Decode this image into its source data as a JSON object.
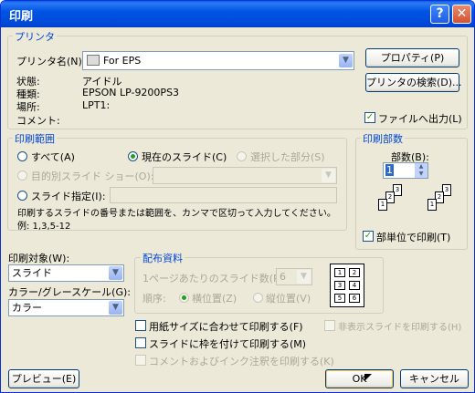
{
  "window": {
    "title": "印刷",
    "help_btn": "?",
    "close_btn": "✕"
  },
  "printer": {
    "group_label": "プリンタ",
    "name_label": "プリンタ名(N):",
    "name_value": "For EPS",
    "properties_btn": "プロパティ(P)",
    "find_btn": "プリンタの検索(D)...",
    "status_label": "状態:",
    "status_value": "アイドル",
    "type_label": "種類:",
    "type_value": "EPSON LP-9200PS3",
    "where_label": "場所:",
    "where_value": "LPT1:",
    "comment_label": "コメント:",
    "print_to_file": "ファイルへ出力(L)"
  },
  "range": {
    "group_label": "印刷範囲",
    "all": "すべて(A)",
    "current": "現在のスライド(C)",
    "selection": "選択した部分(S)",
    "custom_show": "目的別スライド ショー(O):",
    "slides": "スライド指定(I):",
    "help_text": "印刷するスライドの番号または範囲を、カンマで区切って入力してください。",
    "example": "例: 1,3,5-12"
  },
  "copies": {
    "group_label": "印刷部数",
    "count_label": "部数(B):",
    "count_value": "1",
    "collate": "部単位で印刷(T)"
  },
  "print_what": {
    "label": "印刷対象(W):",
    "value": "スライド"
  },
  "color": {
    "label": "カラー/グレースケール(G):",
    "value": "カラー"
  },
  "handouts": {
    "group_label": "配布資料",
    "per_page_label": "1ページあたりのスライド数(R):",
    "per_page_value": "6",
    "order_label": "順序:",
    "horizontal": "横位置(Z)",
    "vertical": "縦位置(V)",
    "grid": [
      "1",
      "2",
      "3",
      "4",
      "5",
      "6"
    ]
  },
  "options": {
    "scale": "用紙サイズに合わせて印刷する(F)",
    "frame": "スライドに枠を付けて印刷する(M)",
    "comments": "コメントおよびインク注釈を印刷する(K)",
    "hidden": "非表示スライドを印刷する(H)"
  },
  "buttons": {
    "preview": "プレビュー(E)",
    "ok": "OK",
    "cancel": "キャンセル"
  }
}
